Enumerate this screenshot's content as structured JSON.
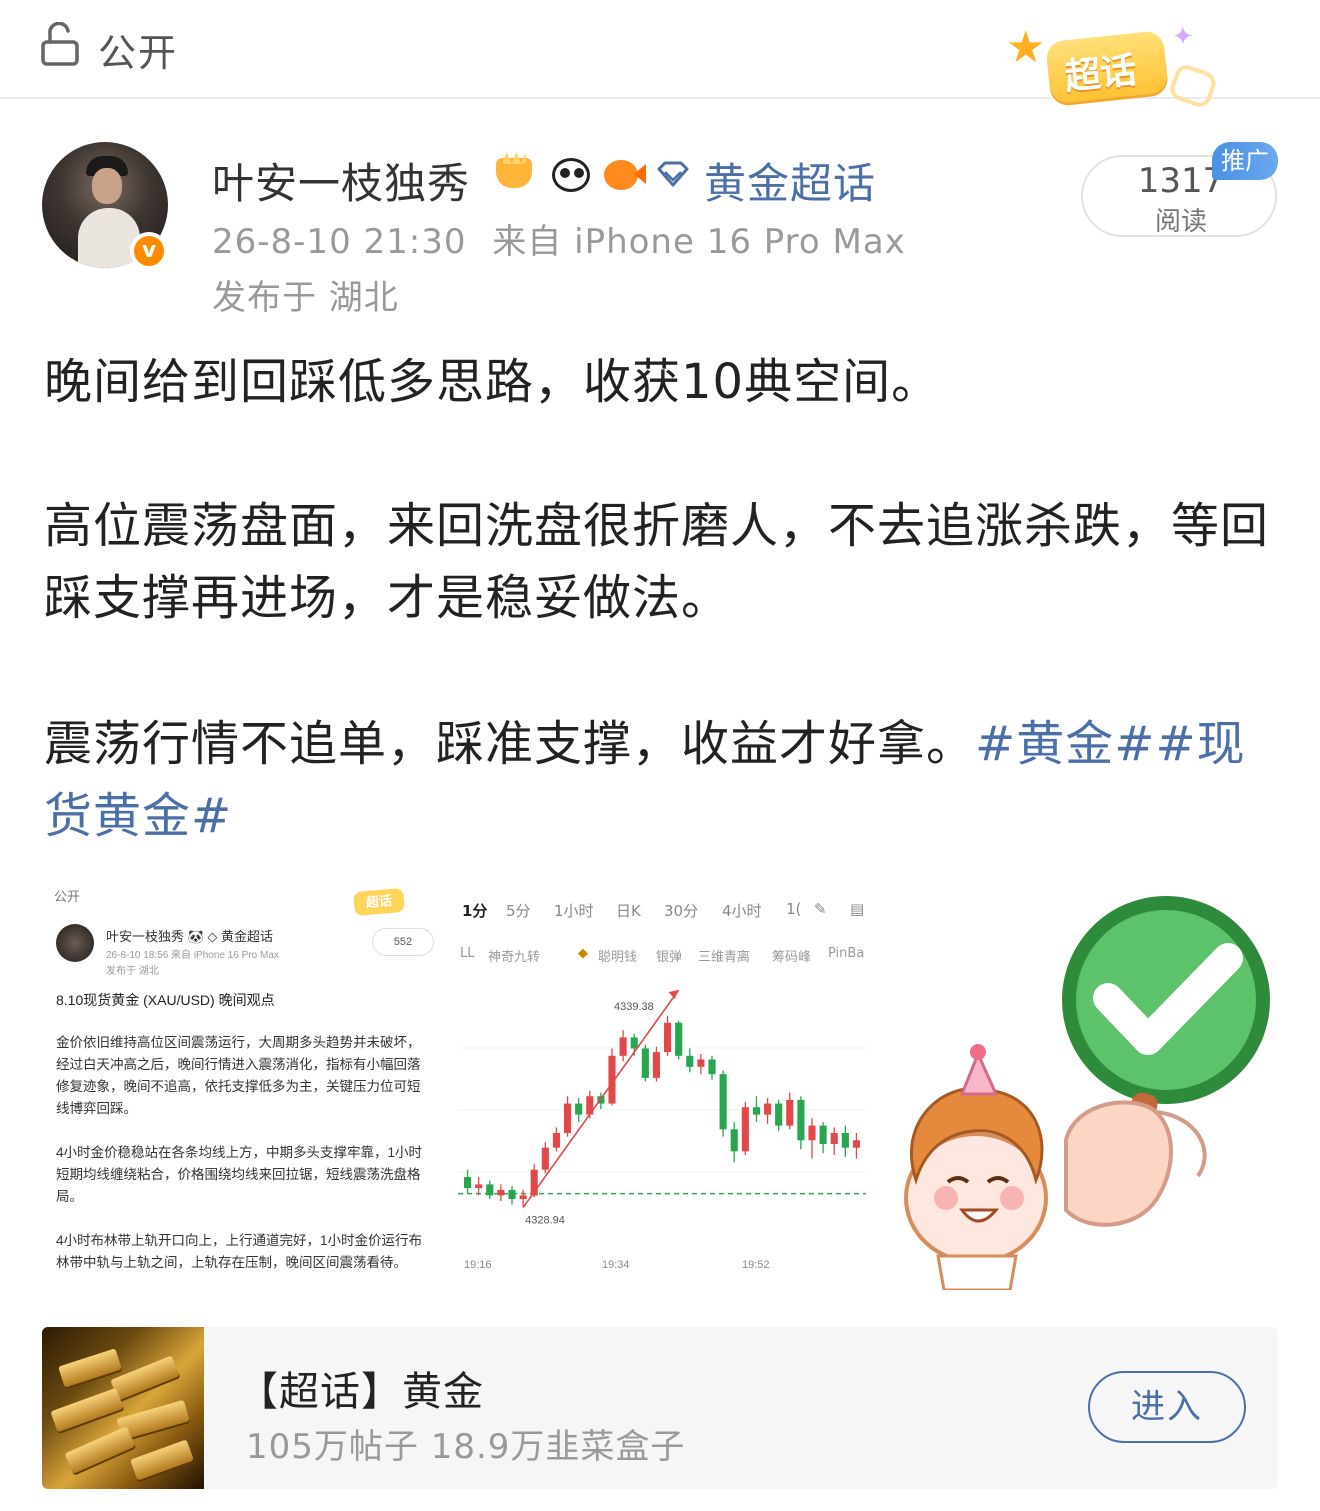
{
  "header": {
    "public_label": "公开",
    "supertopic_badge": "超话"
  },
  "author": {
    "name": "叶安一枝独秀",
    "topic": "黄金超话",
    "avatar_badge": "v",
    "timestamp": "26-8-10 21:30",
    "source": "来自 iPhone 16 Pro Max",
    "location": "发布于 湖北"
  },
  "reads": {
    "count": "1317",
    "label": "阅读",
    "promo_tag": "推广"
  },
  "post": {
    "p1": "晚间给到回踩低多思路，收获10典空间。",
    "p2": "高位震荡盘面，来回洗盘很折磨人，不去追涨杀跌，等回踩支撑再进场，才是稳妥做法。",
    "p3": "震荡行情不追单，踩准支撑，收益才好拿。",
    "hashtags": "#黄金##现货黄金#"
  },
  "image1": {
    "public_label": "公开",
    "badge": "超话",
    "name": "叶安一枝独秀 🐼 ◇ 黄金超话",
    "meta": "26-8-10 18:56  来自 iPhone 16 Pro Max",
    "location": "发布于 湖北",
    "reads": "552",
    "title": "8.10现货黄金 (XAU/USD) 晚间观点",
    "p1": "金价依旧维持高位区间震荡运行，大周期多头趋势并未破坏，经过白天冲高之后，晚间行情进入震荡消化，指标有小幅回落修复迹象，晚间不追高，依托支撑低多为主，关键压力位可短线博弈回踩。",
    "p2": "4小时金价稳稳站在各条均线上方，中期多头支撑牢靠，1小时短期均线缠绕粘合，价格围绕均线来回拉锯，短线震荡洗盘格局。",
    "p3": "4小时布林带上轨开口向上，上行通道完好，1小时金价运行布林带中轨与上轨之间，上轨存在压制，晚间区间震荡看待。"
  },
  "image2": {
    "tabs": [
      "1分",
      "5分",
      "1小时",
      "日K",
      "30分",
      "4小时",
      "1("
    ],
    "indicators": [
      "LL",
      "神奇九转",
      "聪明钱",
      "银弹",
      "三维青离",
      "筹码峰",
      "PinBa"
    ],
    "high_label": "4339.38",
    "low_label": "4328.94",
    "time_labels": [
      "19:16",
      "19:34",
      "19:52"
    ]
  },
  "card": {
    "title": "【超话】黄金",
    "stats": "105万帖子 18.9万韭菜盒子",
    "enter_label": "进入"
  },
  "colors": {
    "link": "#4c6fa8",
    "candle_up": "#e2474a",
    "candle_down": "#27a64f",
    "badge_orange": "#ff8a00",
    "promo_blue": "#4a90e2"
  },
  "chart_data": {
    "type": "candlestick",
    "title": "",
    "xlabel": "",
    "ylabel": "",
    "x_ticks": [
      "19:16",
      "19:34",
      "19:52"
    ],
    "annotations": [
      {
        "label": "4339.38",
        "kind": "high"
      },
      {
        "label": "4328.94",
        "kind": "low"
      }
    ],
    "ylim": [
      4327.5,
      4341
    ],
    "support_level": 4329.7,
    "candles": [
      {
        "o": 4330.6,
        "c": 4330.0,
        "h": 4331.0,
        "l": 4329.7
      },
      {
        "o": 4330.0,
        "c": 4330.2,
        "h": 4330.6,
        "l": 4329.6
      },
      {
        "o": 4330.2,
        "c": 4329.6,
        "h": 4330.4,
        "l": 4329.4
      },
      {
        "o": 4329.6,
        "c": 4329.9,
        "h": 4330.2,
        "l": 4329.3
      },
      {
        "o": 4329.9,
        "c": 4329.4,
        "h": 4330.1,
        "l": 4329.1
      },
      {
        "o": 4329.4,
        "c": 4329.6,
        "h": 4329.9,
        "l": 4328.94
      },
      {
        "o": 4329.6,
        "c": 4331.0,
        "h": 4331.3,
        "l": 4329.5
      },
      {
        "o": 4331.0,
        "c": 4332.2,
        "h": 4332.5,
        "l": 4330.8
      },
      {
        "o": 4332.2,
        "c": 4333.0,
        "h": 4333.3,
        "l": 4332.0
      },
      {
        "o": 4333.0,
        "c": 4334.6,
        "h": 4335.0,
        "l": 4332.8
      },
      {
        "o": 4334.6,
        "c": 4334.0,
        "h": 4334.9,
        "l": 4333.6
      },
      {
        "o": 4334.0,
        "c": 4335.0,
        "h": 4335.3,
        "l": 4333.8
      },
      {
        "o": 4335.0,
        "c": 4334.6,
        "h": 4335.2,
        "l": 4334.3
      },
      {
        "o": 4334.6,
        "c": 4337.2,
        "h": 4337.6,
        "l": 4334.5
      },
      {
        "o": 4337.2,
        "c": 4338.2,
        "h": 4338.6,
        "l": 4336.9
      },
      {
        "o": 4338.2,
        "c": 4337.6,
        "h": 4338.4,
        "l": 4337.2
      },
      {
        "o": 4337.6,
        "c": 4336.0,
        "h": 4337.8,
        "l": 4335.8
      },
      {
        "o": 4336.0,
        "c": 4337.4,
        "h": 4337.7,
        "l": 4335.8
      },
      {
        "o": 4337.4,
        "c": 4339.0,
        "h": 4339.38,
        "l": 4337.2
      },
      {
        "o": 4339.0,
        "c": 4337.2,
        "h": 4339.1,
        "l": 4337.0
      },
      {
        "o": 4337.2,
        "c": 4336.6,
        "h": 4337.6,
        "l": 4336.3
      },
      {
        "o": 4336.6,
        "c": 4337.0,
        "h": 4337.3,
        "l": 4336.2
      },
      {
        "o": 4337.0,
        "c": 4336.2,
        "h": 4337.2,
        "l": 4335.9
      },
      {
        "o": 4336.2,
        "c": 4333.2,
        "h": 4336.4,
        "l": 4332.8
      },
      {
        "o": 4333.2,
        "c": 4332.0,
        "h": 4333.6,
        "l": 4331.4
      },
      {
        "o": 4332.0,
        "c": 4334.4,
        "h": 4334.7,
        "l": 4331.8
      },
      {
        "o": 4334.4,
        "c": 4334.0,
        "h": 4335.0,
        "l": 4333.6
      },
      {
        "o": 4334.0,
        "c": 4334.6,
        "h": 4334.9,
        "l": 4333.5
      },
      {
        "o": 4334.6,
        "c": 4333.4,
        "h": 4334.8,
        "l": 4333.1
      },
      {
        "o": 4333.4,
        "c": 4334.8,
        "h": 4335.2,
        "l": 4333.2
      },
      {
        "o": 4334.8,
        "c": 4332.6,
        "h": 4335.0,
        "l": 4332.1
      },
      {
        "o": 4332.6,
        "c": 4333.4,
        "h": 4333.8,
        "l": 4331.6
      },
      {
        "o": 4333.4,
        "c": 4332.4,
        "h": 4333.6,
        "l": 4331.9
      },
      {
        "o": 4332.4,
        "c": 4333.0,
        "h": 4333.3,
        "l": 4331.8
      },
      {
        "o": 4333.0,
        "c": 4332.2,
        "h": 4333.4,
        "l": 4331.7
      },
      {
        "o": 4332.2,
        "c": 4332.6,
        "h": 4333.0,
        "l": 4331.6
      }
    ]
  }
}
